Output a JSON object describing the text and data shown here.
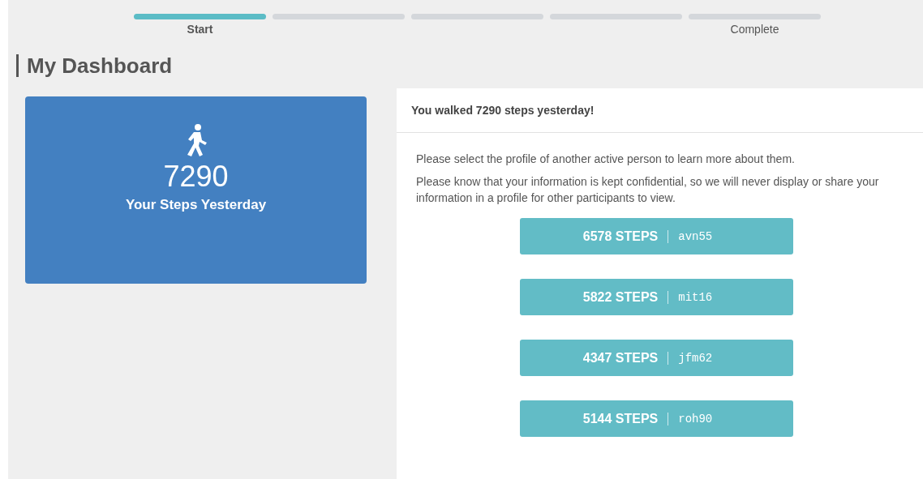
{
  "progress": [
    {
      "label": "Start",
      "selected": true
    },
    {
      "selected": false
    },
    {
      "selected": false
    },
    {
      "selected": false
    },
    {
      "label": "Complete",
      "selected": false
    }
  ],
  "title": "My Dashboard",
  "summary_card": {
    "value": "7290",
    "caption": "Your Steps Yesterday"
  },
  "panel": {
    "heading": "You walked 7290 steps yesterday!",
    "paragraphs": [
      "Please select the profile of another active person to learn more about them.",
      "Please know that your information is kept confidential, so we will never display or share your information in a profile for other participants to view."
    ],
    "profiles": [
      {
        "steps": "6578 STEPS",
        "user": "avn55"
      },
      {
        "steps": "5822 STEPS",
        "user": "mit16"
      },
      {
        "steps": "4347 STEPS",
        "user": "jfm62"
      },
      {
        "steps": "5144 STEPS",
        "user": "roh90"
      }
    ]
  }
}
